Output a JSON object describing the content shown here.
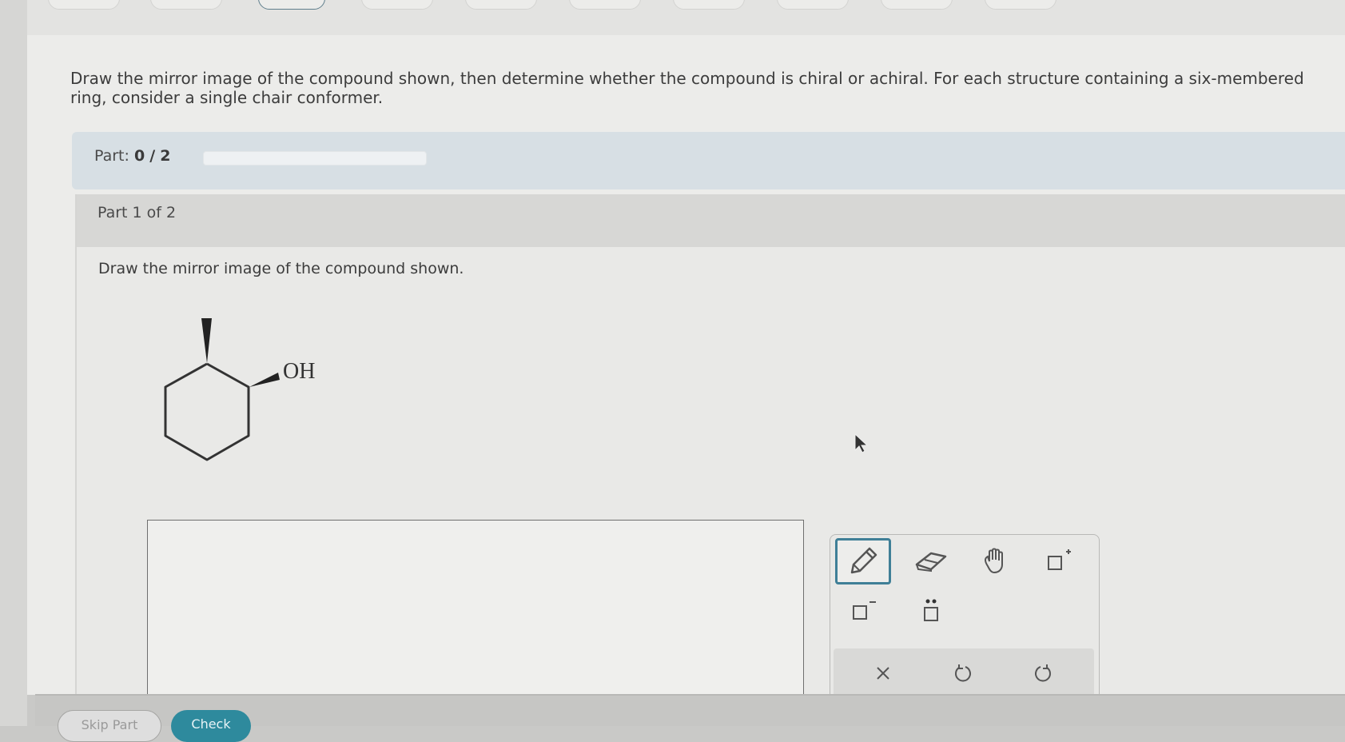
{
  "question": {
    "text": "Draw the mirror image of the compound shown, then determine whether the compound is chiral or achiral. For each structure containing a six-membered ring, consider a single chair conformer."
  },
  "progress": {
    "label": "Part:",
    "current": "0",
    "separator": "/",
    "total": "2",
    "fraction": 0
  },
  "part": {
    "header": "Part 1 of 2",
    "prompt": "Draw the mirror image of the compound shown."
  },
  "molecule": {
    "substituent_label": "OH"
  },
  "toolbar": {
    "tools": [
      {
        "name": "pencil",
        "selected": true
      },
      {
        "name": "eraser",
        "selected": false
      },
      {
        "name": "hand",
        "selected": false
      },
      {
        "name": "positive-charge",
        "selected": false
      },
      {
        "name": "negative-charge",
        "selected": false
      },
      {
        "name": "lone-pair",
        "selected": false
      }
    ],
    "actions": [
      "clear",
      "undo",
      "redo"
    ]
  },
  "footer": {
    "skip_label": "Skip Part",
    "check_label": "Check"
  },
  "colors": {
    "accent": "#3f7f97",
    "check_button": "#2e8a9d",
    "part_bar": "#d7dfe4"
  }
}
